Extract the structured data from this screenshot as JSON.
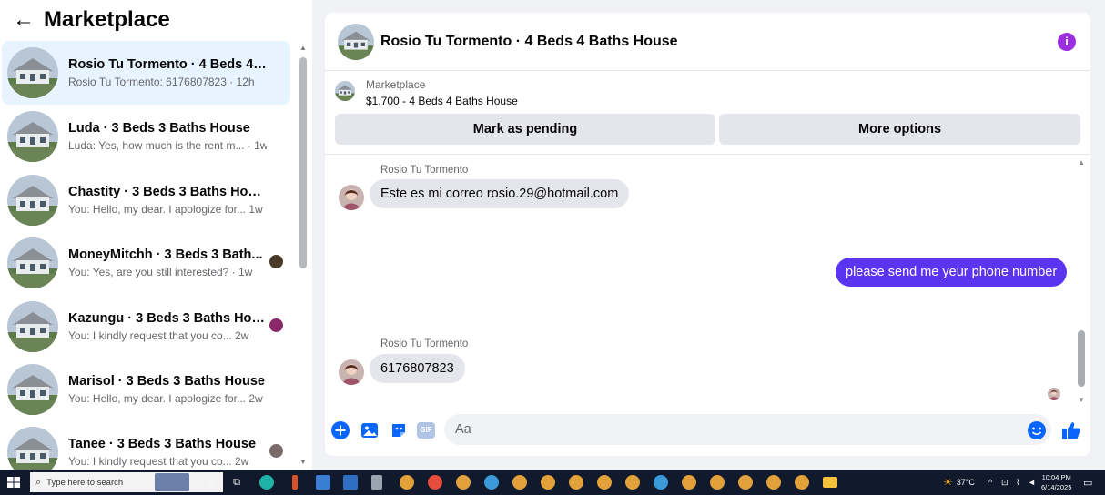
{
  "sidebar": {
    "title": "Marketplace",
    "back_icon": "arrow-left-icon",
    "conversations": [
      {
        "name": "Rosio Tu Tormento · 4 Beds 4 Ba...",
        "sub": "Rosio Tu Tormento: 6176807823 · 12h",
        "active": true
      },
      {
        "name": "Luda · 3 Beds 3 Baths House",
        "sub": "Luda: Yes, how much is the rent m... · 1w"
      },
      {
        "name": "Chastity · 3 Beds 3 Baths House",
        "sub": "You: Hello, my dear. I apologize for... 1w"
      },
      {
        "name": "MoneyMitchh · 3 Beds 3 Bath...",
        "sub": "You: Yes, are you still interested? · 1w"
      },
      {
        "name": "Kazungu · 3 Beds 3 Baths Hou...",
        "sub": "You: I kindly request that you co... 2w"
      },
      {
        "name": "Marisol · 3 Beds 3 Baths House",
        "sub": "You: Hello, my dear. I apologize for... 2w"
      },
      {
        "name": "Tanee · 3 Beds 3 Baths House",
        "sub": "You: I kindly request that you co... 2w"
      }
    ]
  },
  "chat": {
    "title": "Rosio Tu Tormento · 4 Beds 4 Baths House",
    "info_icon": "info-icon",
    "marketplace_label": "Marketplace",
    "listing": "$1,700 - 4 Beds 4 Baths House",
    "mark_pending": "Mark as pending",
    "more_options": "More options",
    "messages": [
      {
        "sender": "Rosio Tu Tormento",
        "text": "Este es mi correo rosio.29@hotmail.com",
        "direction": "in"
      },
      {
        "text": "please send me yeur  phone number",
        "direction": "out"
      },
      {
        "sender": "Rosio Tu Tormento",
        "text": "6176807823",
        "direction": "in"
      }
    ],
    "composer": {
      "placeholder": "Aa",
      "icons": [
        "plus-circle-icon",
        "image-icon",
        "sticker-icon",
        "gif-icon",
        "emoji-icon",
        "thumbs-up-icon"
      ],
      "gif_label": "GIF"
    }
  },
  "taskbar": {
    "search_placeholder": "Type here to search",
    "temperature": "37°C",
    "time": "10:04 PM",
    "date": "6/14/2025",
    "accent": "#5b34ef"
  }
}
